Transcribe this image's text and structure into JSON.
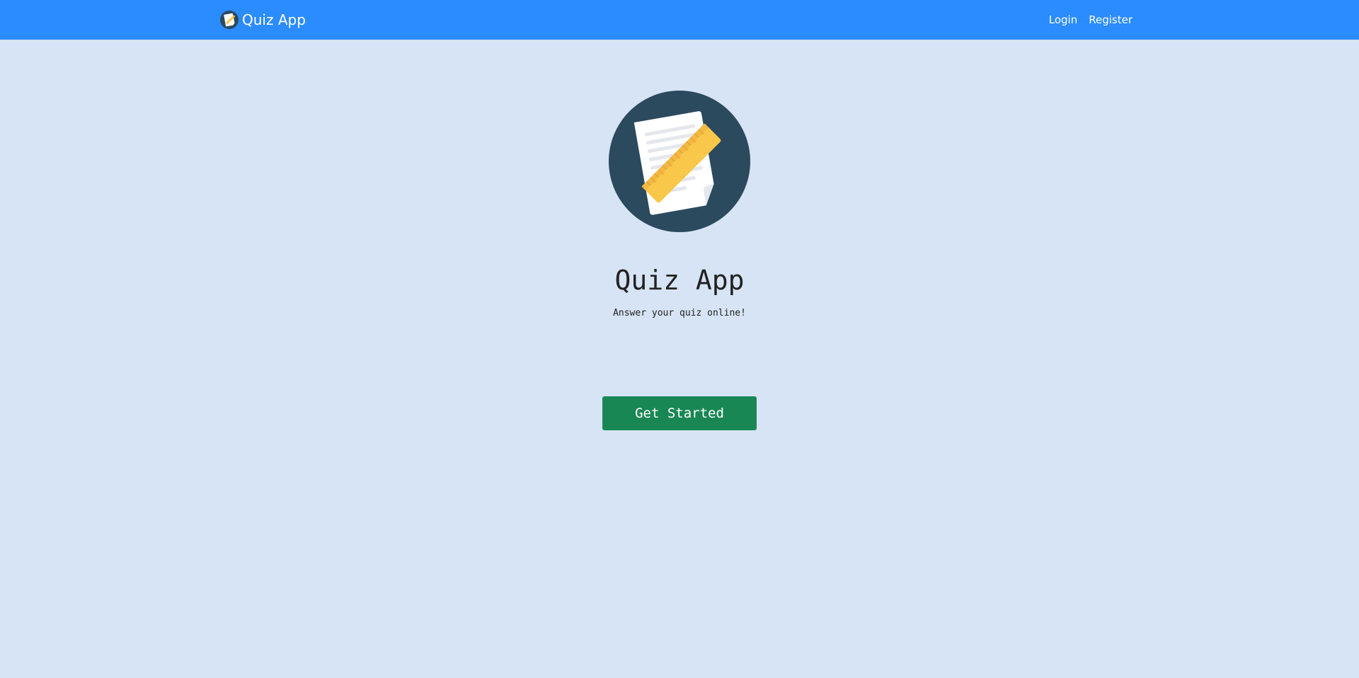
{
  "navbar": {
    "brand_text": "Quiz App",
    "brand_logo_icon": "notepad-ruler-icon",
    "links": [
      {
        "label": "Login"
      },
      {
        "label": "Register"
      }
    ],
    "background_color": "#2b8cff"
  },
  "hero": {
    "logo_icon": "notepad-ruler-icon",
    "title": "Quiz App",
    "subtitle": "Answer your quiz online!",
    "cta_label": "Get Started",
    "cta_color": "#198754"
  },
  "page": {
    "background_color": "#d6e4f5"
  }
}
